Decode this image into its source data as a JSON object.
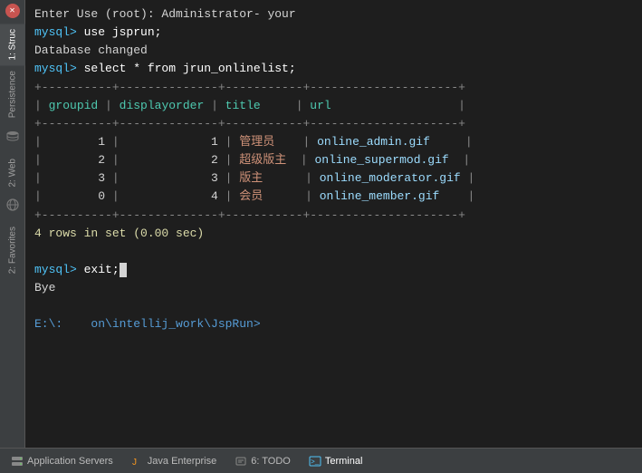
{
  "terminal": {
    "lines": [
      {
        "type": "output",
        "text": "Enter Use (root): Administrator- your"
      },
      {
        "type": "prompt-cmd",
        "prompt": "mysql> ",
        "command": "use jsprun;"
      },
      {
        "type": "output",
        "text": "Database changed"
      },
      {
        "type": "prompt-cmd",
        "prompt": "mysql> ",
        "command": "select * from jrun_onlinelist;"
      },
      {
        "type": "table-border",
        "text": "+----------+--------------+-----------+--------------------+"
      },
      {
        "type": "table-header",
        "text": "| groupid  | displayorder | title     | url                |"
      },
      {
        "type": "table-border",
        "text": "+----------+--------------+-----------+--------------------+"
      },
      {
        "type": "table-row1",
        "groupid": "1",
        "displayorder": "1",
        "title": "管理员",
        "url": "online_admin.gif"
      },
      {
        "type": "table-row2",
        "groupid": "2",
        "displayorder": "2",
        "title": "超级版主",
        "url": "online_supermod.gif"
      },
      {
        "type": "table-row3",
        "groupid": "3",
        "displayorder": "3",
        "title": "版主",
        "url": "online_moderator.gif"
      },
      {
        "type": "table-row4",
        "groupid": "0",
        "displayorder": "4",
        "title": "会员",
        "url": "online_member.gif"
      },
      {
        "type": "table-border",
        "text": "+----------+--------------+-----------+--------------------+"
      },
      {
        "type": "result",
        "text": "4 rows in set (0.00 sec)"
      },
      {
        "type": "blank"
      },
      {
        "type": "prompt-cmd",
        "prompt": "mysql> ",
        "command": "exit;"
      },
      {
        "type": "output",
        "text": "Bye"
      },
      {
        "type": "blank"
      },
      {
        "type": "path",
        "text": "E:\\:    on\\intellij_work\\JspRun>"
      }
    ]
  },
  "sidebar": {
    "tabs": [
      {
        "label": "1: Struc",
        "active": true
      },
      {
        "label": "Persistence",
        "active": false
      },
      {
        "label": "2: Web",
        "active": false
      },
      {
        "label": "2: Favorites",
        "active": false
      }
    ]
  },
  "toolbar": {
    "items": [
      {
        "icon": "server-icon",
        "label": "Application Servers"
      },
      {
        "icon": "java-icon",
        "label": "Java Enterprise"
      },
      {
        "icon": "todo-icon",
        "label": "6: TODO"
      },
      {
        "icon": "terminal-icon",
        "label": "Terminal",
        "active": true
      }
    ]
  }
}
